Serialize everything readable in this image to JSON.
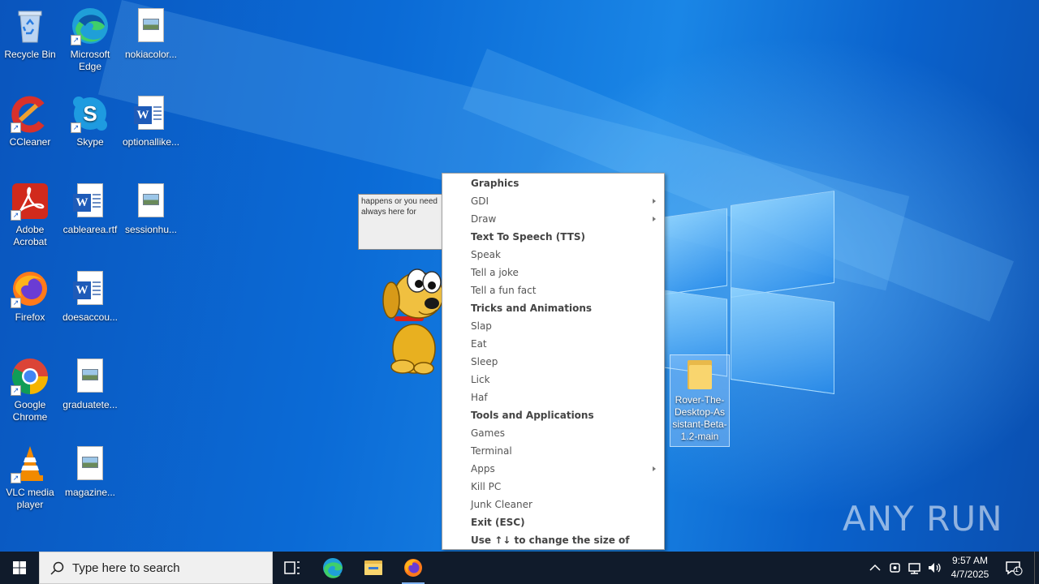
{
  "desktop": {
    "icons": [
      {
        "label": "Recycle Bin"
      },
      {
        "label": "Microsoft Edge"
      },
      {
        "label": "nokiacolor..."
      },
      {
        "label": "CCleaner"
      },
      {
        "label": "Skype"
      },
      {
        "label": "optionallike..."
      },
      {
        "label": "Adobe Acrobat"
      },
      {
        "label": "cablearea.rtf"
      },
      {
        "label": "sessionhu..."
      },
      {
        "label": "Firefox"
      },
      {
        "label": "doesaccou..."
      },
      {
        "label": "Google Chrome"
      },
      {
        "label": "graduatete..."
      },
      {
        "label": "VLC media player"
      },
      {
        "label": "magazine..."
      }
    ],
    "selected_folder": {
      "label": "Rover-The-Desktop-Assistant-Beta-1.2-main"
    }
  },
  "speech_bubble": {
    "line1": "happens or you need",
    "line2": "always here for"
  },
  "context_menu": {
    "items": [
      {
        "label": "Graphics",
        "type": "header"
      },
      {
        "label": "GDI",
        "type": "submenu"
      },
      {
        "label": "Draw",
        "type": "submenu"
      },
      {
        "label": "Text To Speech (TTS)",
        "type": "header"
      },
      {
        "label": "Speak",
        "type": "item"
      },
      {
        "label": "Tell a joke",
        "type": "item"
      },
      {
        "label": "Tell a fun fact",
        "type": "item"
      },
      {
        "label": "Tricks and Animations",
        "type": "header"
      },
      {
        "label": "Slap",
        "type": "item"
      },
      {
        "label": "Eat",
        "type": "item"
      },
      {
        "label": "Sleep",
        "type": "item"
      },
      {
        "label": "Lick",
        "type": "item"
      },
      {
        "label": "Haf",
        "type": "item"
      },
      {
        "label": "Tools and Applications",
        "type": "header"
      },
      {
        "label": "Games",
        "type": "item"
      },
      {
        "label": "Terminal",
        "type": "item"
      },
      {
        "label": "Apps",
        "type": "submenu"
      },
      {
        "label": "Kill PC",
        "type": "item"
      },
      {
        "label": "Junk Cleaner",
        "type": "item"
      },
      {
        "label": "Exit (ESC)",
        "type": "header"
      },
      {
        "label": "Use ↑↓ to change the size of Rover",
        "type": "header"
      }
    ]
  },
  "watermark": {
    "text": "ANY RUN"
  },
  "taskbar": {
    "search_placeholder": "Type here to search",
    "clock_time": "9:57 AM",
    "clock_date": "4/7/2025",
    "notification_count": "1"
  }
}
